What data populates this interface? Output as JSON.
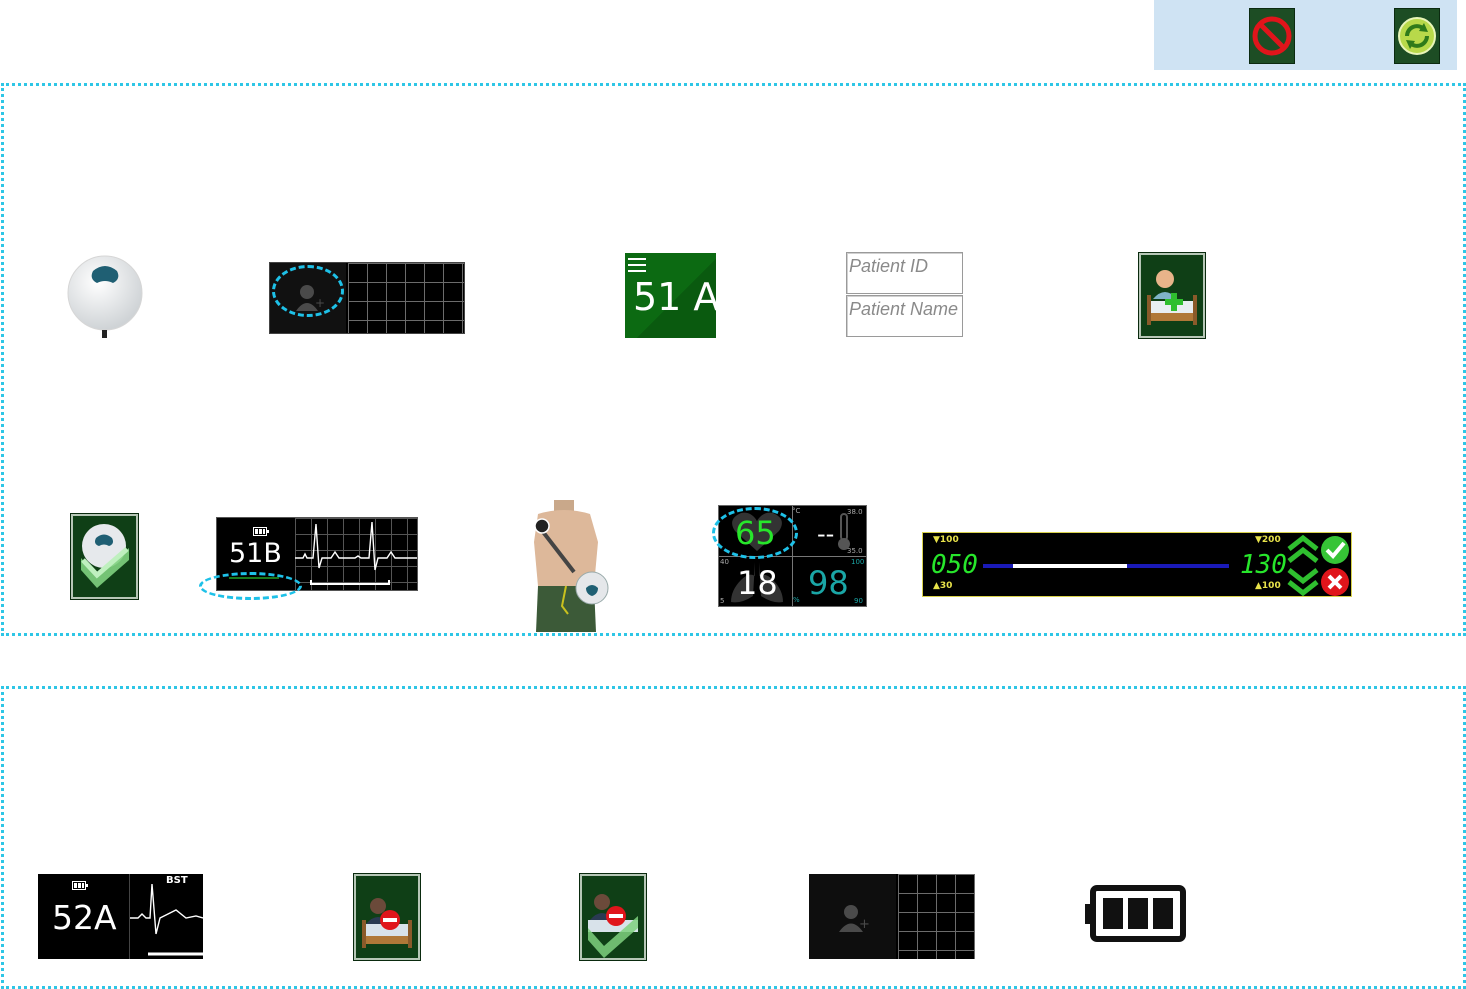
{
  "toolbar": {
    "bg_color": "#cfe3f3",
    "buttons": [
      {
        "icon": "no-entry-icon"
      },
      {
        "icon": "refresh-icon"
      }
    ]
  },
  "region_top": {
    "row1": {
      "sensor_icon": "wearable-sensor-icon",
      "add_patient_icon": "add-patient-icon",
      "bed_tile": {
        "bed_number": "51 A",
        "menu_icon": "hamburger-icon",
        "color": "#0b6b12"
      },
      "patient_form": {
        "id_placeholder": "Patient ID",
        "name_placeholder": "Patient Name"
      },
      "admit_icon": "admit-patient-bed-icon"
    },
    "row2": {
      "confirm_sensor_icon": "confirm-sensor-icon",
      "bed_tile_51b": {
        "bed_number": "51B",
        "battery_icon": "battery-icon"
      },
      "torso_icon": "torso-sensor-placement-icon",
      "vitals": {
        "heart_rate": "65",
        "temperature": "--",
        "temp_unit": "°C",
        "temp_high": "38.0",
        "temp_low": "35.0",
        "resp_rate": "18",
        "resp_high": "40",
        "resp_low": "5",
        "spo2": "98",
        "spo2_high": "100",
        "spo2_low": "90",
        "spo2_unit": "%"
      },
      "alarm_limits": {
        "low_top": "▼100",
        "low_bottom": "▲30",
        "low_value": "050",
        "high_top": "▼200",
        "high_bottom": "▲100",
        "high_value": "130",
        "up_icon": "double-chevron-up-icon",
        "down_icon": "double-chevron-down-icon",
        "accept_icon": "check-circle-icon",
        "reject_icon": "x-circle-icon"
      }
    }
  },
  "region_bottom": {
    "bed_tile_52a": {
      "bed_number": "52A",
      "label": "BST",
      "battery_icon": "battery-icon"
    },
    "discharge_icon": "discharge-patient-icon",
    "discharge_confirm_icon": "discharge-confirm-icon",
    "add_patient_icon": "add-patient-icon",
    "battery_full_icon": "battery-full-icon"
  },
  "colors": {
    "accent_dashed": "#1ec1e8",
    "lcd_green": "#27e62b",
    "bed_green": "#0b6b12"
  }
}
